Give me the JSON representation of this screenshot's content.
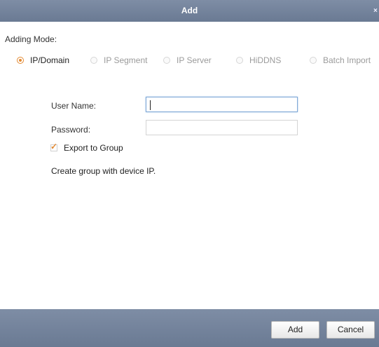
{
  "window": {
    "title": "Add",
    "close_glyph": "×"
  },
  "adding_mode": {
    "label": "Adding Mode:",
    "options": [
      {
        "label": "IP/Domain",
        "selected": true
      },
      {
        "label": "IP Segment",
        "selected": false
      },
      {
        "label": "IP Server",
        "selected": false
      },
      {
        "label": "HiDDNS",
        "selected": false
      },
      {
        "label": "Batch Import",
        "selected": false
      }
    ]
  },
  "form": {
    "user_name_label": "User Name:",
    "user_name_value": "",
    "password_label": "Password:",
    "password_value": "",
    "export_to_group_label": "Export to Group",
    "export_to_group_checked": true,
    "hint": "Create group with device IP."
  },
  "footer": {
    "add_label": "Add",
    "cancel_label": "Cancel"
  },
  "colors": {
    "title_bar": "#7283a0",
    "accent": "#e38a33"
  }
}
